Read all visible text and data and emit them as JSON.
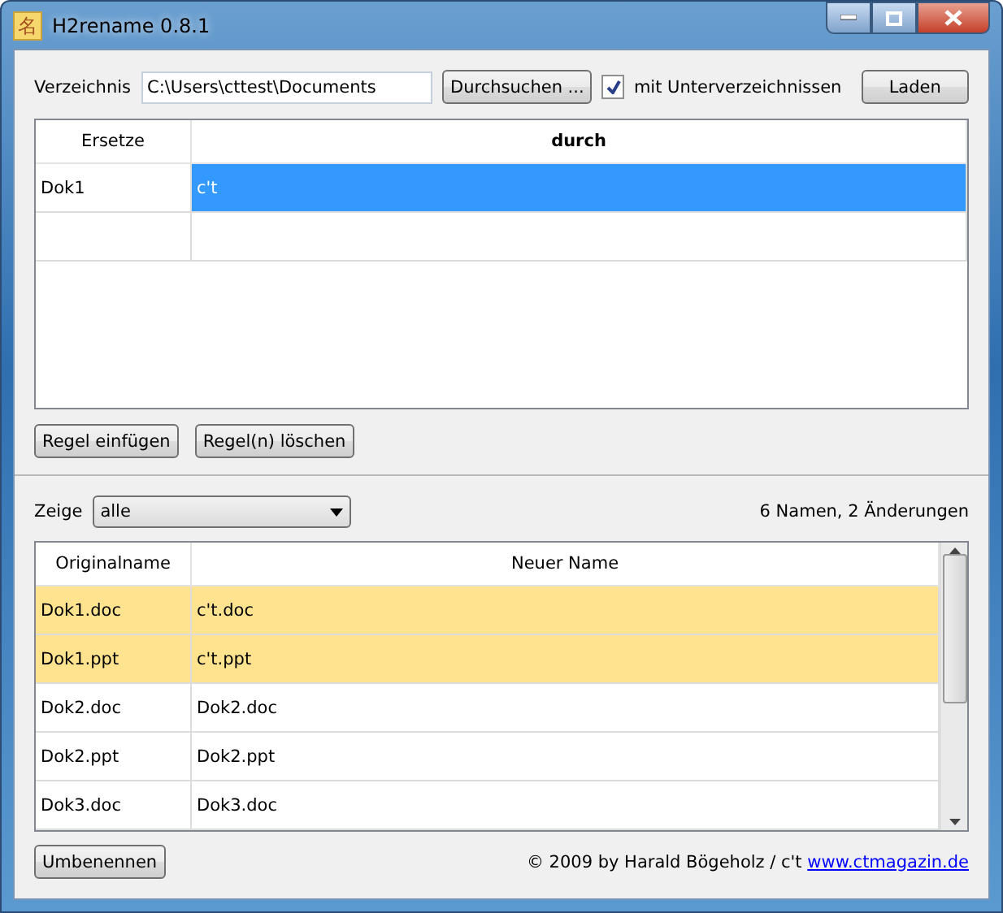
{
  "window": {
    "icon_glyph": "名",
    "title": "H2rename 0.8.1"
  },
  "directory": {
    "label": "Verzeichnis",
    "value": "C:\\Users\\cttest\\Documents",
    "browse_button": "Durchsuchen ...",
    "subdirs": {
      "label": "mit Unterverzeichnissen",
      "checked": true
    },
    "load_button": "Laden"
  },
  "rules": {
    "columns": [
      "Ersetze",
      "durch"
    ],
    "rows": [
      {
        "cells": [
          "Dok1",
          "c't"
        ],
        "selected": true
      },
      {
        "cells": [
          "",
          ""
        ],
        "selected": false
      }
    ]
  },
  "rule_buttons": [
    "Regel einfügen",
    "Regel(n) löschen"
  ],
  "filter": {
    "label": "Zeige",
    "value": "alle",
    "summary": "6 Namen, 2 Änderungen"
  },
  "files": {
    "columns": [
      "Originalname",
      "Neuer Name"
    ],
    "rows": [
      {
        "cells": [
          "Dok1.doc",
          "c't.doc"
        ],
        "changed": true
      },
      {
        "cells": [
          "Dok1.ppt",
          "c't.ppt"
        ],
        "changed": true
      },
      {
        "cells": [
          "Dok2.doc",
          "Dok2.doc"
        ],
        "changed": false
      },
      {
        "cells": [
          "Dok2.ppt",
          "Dok2.ppt"
        ],
        "changed": false
      },
      {
        "cells": [
          "Dok3.doc",
          "Dok3.doc"
        ],
        "changed": false
      }
    ]
  },
  "rename_button": "Umbenennen",
  "footer": {
    "credit": "© 2009 by Harald Bögeholz / c't",
    "link": "www.ctmagazin.de"
  }
}
